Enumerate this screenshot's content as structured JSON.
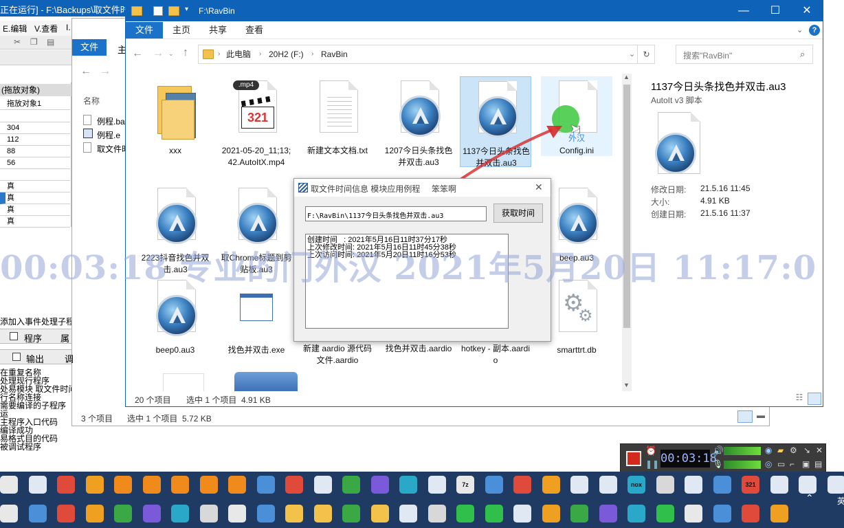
{
  "bg_window": {
    "title": "正在运行] - F:\\Backups\\取文件时",
    "menu": [
      "E.编辑",
      "V.查看",
      "I."
    ],
    "inner_tabs": [
      "文件",
      "主"
    ],
    "col_header": "名称",
    "files": [
      "例程.ba",
      "例程.e",
      "取文件时"
    ],
    "status_count": "3 个项目",
    "status_selected": "选中 1 个项目  5.72 KB"
  },
  "left_panel": {
    "group_header": "(拖放对象)",
    "rows": [
      "拖放对象1",
      "",
      "304",
      "112",
      "88",
      "56",
      "",
      "真",
      "真",
      "真",
      "真"
    ],
    "event_hint": "添加入事件处理子程",
    "tabs": [
      "程序",
      "属"
    ],
    "tabs2": [
      "输出",
      "调"
    ],
    "output_lines": [
      "在重复名称",
      "处理现行程序",
      "处易模块 取文件时间",
      "行名称连接",
      "需要编译的子程序",
      "运",
      "主程序入口代码",
      "编译成功",
      "易格式目的代码",
      "被调试程序"
    ]
  },
  "explorer": {
    "title": "F:\\RavBin",
    "tabs": [
      "文件",
      "主页",
      "共享",
      "查看"
    ],
    "help": "?",
    "breadcrumb": [
      "此电脑",
      "20H2 (F:)",
      "RavBin"
    ],
    "search_placeholder": "搜索\"RavBin\"",
    "items": [
      {
        "name": "xxx",
        "kind": "folder"
      },
      {
        "name": "2021-05-20_11;13;42.AutoItX.mp4",
        "kind": "mp4",
        "badge": ".mp4"
      },
      {
        "name": "新建文本文档.txt",
        "kind": "txt"
      },
      {
        "name": "1207今日头条找色并双击.au3",
        "kind": "au3"
      },
      {
        "name": "1137今日头条找色并双击.au3",
        "kind": "au3",
        "selected": true
      },
      {
        "name": "Config.ini",
        "kind": "ini"
      },
      {
        "name": "2223抖音找色并双击.au3",
        "kind": "au3"
      },
      {
        "name": "取Chrome标题到剪贴板.au3",
        "kind": "au3"
      },
      {
        "name": "beep.au3",
        "kind": "au3"
      },
      {
        "name": "beep0.au3",
        "kind": "au3"
      },
      {
        "name": "找色并双击.exe",
        "kind": "exe"
      },
      {
        "name": "新建 aardio 源代码文件.aardio",
        "kind": "hidden"
      },
      {
        "name": "找色并双击.aardio",
        "kind": "hidden"
      },
      {
        "name": "hotkey - 副本.aardio",
        "kind": "hidden"
      },
      {
        "name": "smarttrt.db",
        "kind": "db"
      }
    ],
    "overlay_text": "门\n外汉",
    "status_count": "20 个项目",
    "status_selected": "选中 1 个项目  4.91 KB"
  },
  "details": {
    "title": "1137今日头条找色并双击.au3",
    "type": "AutoIt v3 脚本",
    "modified_label": "修改日期:",
    "modified": "21.5.16 11:45",
    "size_label": "大小:",
    "size": "4.91 KB",
    "created_label": "创建日期:",
    "created": "21.5.16 11:37"
  },
  "dialog": {
    "title": "取文件时间信息 模块应用例程",
    "author": "笨笨啊",
    "path_value": "F:\\RavBin\\1137今日头条找色并双击.au3",
    "button": "获取时间",
    "lines": [
      "创建时间   : 2021年5月16日11时37分17秒",
      "上次修改时间: 2021年5月16日11时45分38秒",
      "上次访问时间: 2021年5月20日11时16分53秒"
    ]
  },
  "watermark": "00:03:18 专业的门外汉 2021年5月20日 11:17:0",
  "recorder": {
    "time": "00:03:18"
  },
  "colors": {
    "accent": "#0e62b8",
    "selection": "#cce4f7",
    "taskbar": "#1f3a63"
  },
  "taskbar": {
    "row1": [
      "chrome-icon",
      "window-icon",
      "color-icon",
      "record-icon",
      "search-icon",
      "search-icon",
      "search-icon",
      "search-icon",
      "search-icon",
      "mark-icon",
      "autoit-icon",
      "window-icon",
      "book-icon",
      "bug-icon",
      "dot-icon",
      "window-icon",
      "7z-icon",
      "monitor-icon",
      "file-icon",
      "face-icon",
      "window-icon",
      "window-icon",
      "nox-icon",
      "paint-icon",
      "window-icon",
      "tree-icon",
      "321-icon",
      "window-icon",
      "window-icon",
      "window-icon"
    ],
    "row2": [
      "lala-icon",
      "camera-icon",
      "key-icon",
      "network-icon",
      "ie-icon",
      "autoit-icon",
      "net-icon",
      "globe-icon",
      "r-icon",
      "find-icon",
      "folder-icon",
      "folder-icon",
      "trash-icon",
      "folder-icon",
      "window-icon",
      "rotate-icon",
      "g-icon",
      "g-icon",
      "window-icon",
      "plane-icon",
      "plane-icon",
      "t-icon",
      "z-icon",
      "g-icon",
      "obs-icon",
      "frame-icon",
      "d-icon",
      "b-icon"
    ],
    "row1_labels": {
      "7z-icon": "7z",
      "nox-icon": "nox",
      "321-icon": "321"
    },
    "edge_label": "英"
  }
}
